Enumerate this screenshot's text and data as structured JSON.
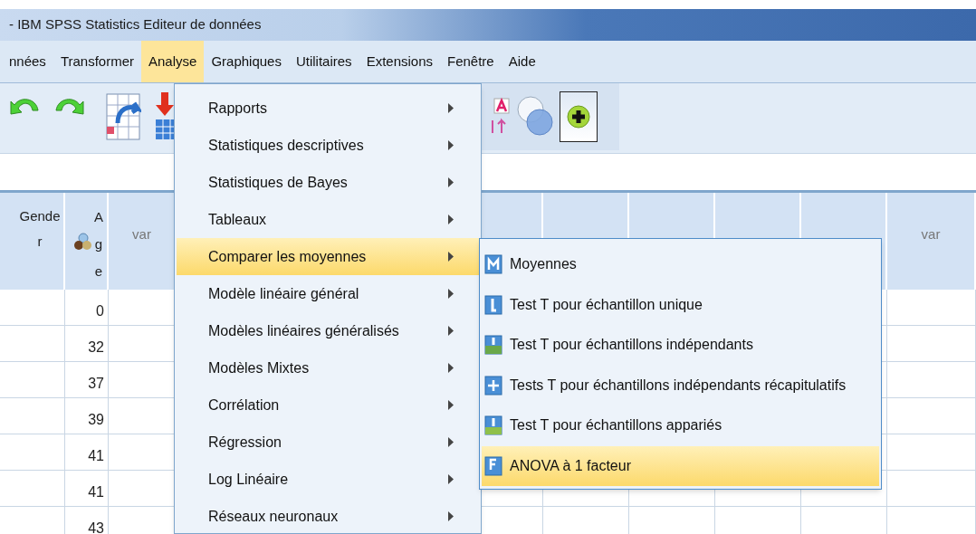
{
  "window": {
    "title": "- IBM SPSS Statistics Editeur de données"
  },
  "menu_bar": [
    {
      "label": "nnées",
      "selected": false
    },
    {
      "label": "Transformer",
      "selected": false
    },
    {
      "label": "Analyse",
      "selected": true
    },
    {
      "label": "Graphiques",
      "selected": false
    },
    {
      "label": "Utilitaires",
      "selected": false
    },
    {
      "label": "Extensions",
      "selected": false
    },
    {
      "label": "Fenêtre",
      "selected": false
    },
    {
      "label": "Aide",
      "selected": false
    }
  ],
  "grid": {
    "columns": [
      {
        "label": "Gender"
      },
      {
        "label": "Age"
      },
      {
        "label": "var"
      },
      {
        "label": "var"
      }
    ],
    "rows": [
      {
        "age": "0"
      },
      {
        "age": "32"
      },
      {
        "age": "37"
      },
      {
        "age": "39"
      },
      {
        "age": "41"
      },
      {
        "age": "41"
      },
      {
        "age": "43"
      }
    ]
  },
  "analyse_menu": [
    {
      "label": "Rapports",
      "selected": false
    },
    {
      "label": "Statistiques descriptives",
      "selected": false
    },
    {
      "label": "Statistiques de Bayes",
      "selected": false
    },
    {
      "label": "Tableaux",
      "selected": false
    },
    {
      "label": "Comparer les moyennes",
      "selected": true
    },
    {
      "label": "Modèle linéaire général",
      "selected": false
    },
    {
      "label": "Modèles linéaires généralisés",
      "selected": false
    },
    {
      "label": "Modèles Mixtes",
      "selected": false
    },
    {
      "label": "Corrélation",
      "selected": false
    },
    {
      "label": "Régression",
      "selected": false
    },
    {
      "label": "Log Linéaire",
      "selected": false
    },
    {
      "label": "Réseaux neuronaux",
      "selected": false
    }
  ],
  "compare_means_submenu": [
    {
      "label": "Moyennes",
      "selected": false
    },
    {
      "label": "Test T pour échantillon unique",
      "selected": false
    },
    {
      "label": "Test T pour échantillons indépendants",
      "selected": false
    },
    {
      "label": "Tests T pour échantillons indépendants récapitulatifs",
      "selected": false
    },
    {
      "label": "Test T pour échantillons appariés",
      "selected": false
    },
    {
      "label": "ANOVA à 1 facteur",
      "selected": true
    }
  ]
}
